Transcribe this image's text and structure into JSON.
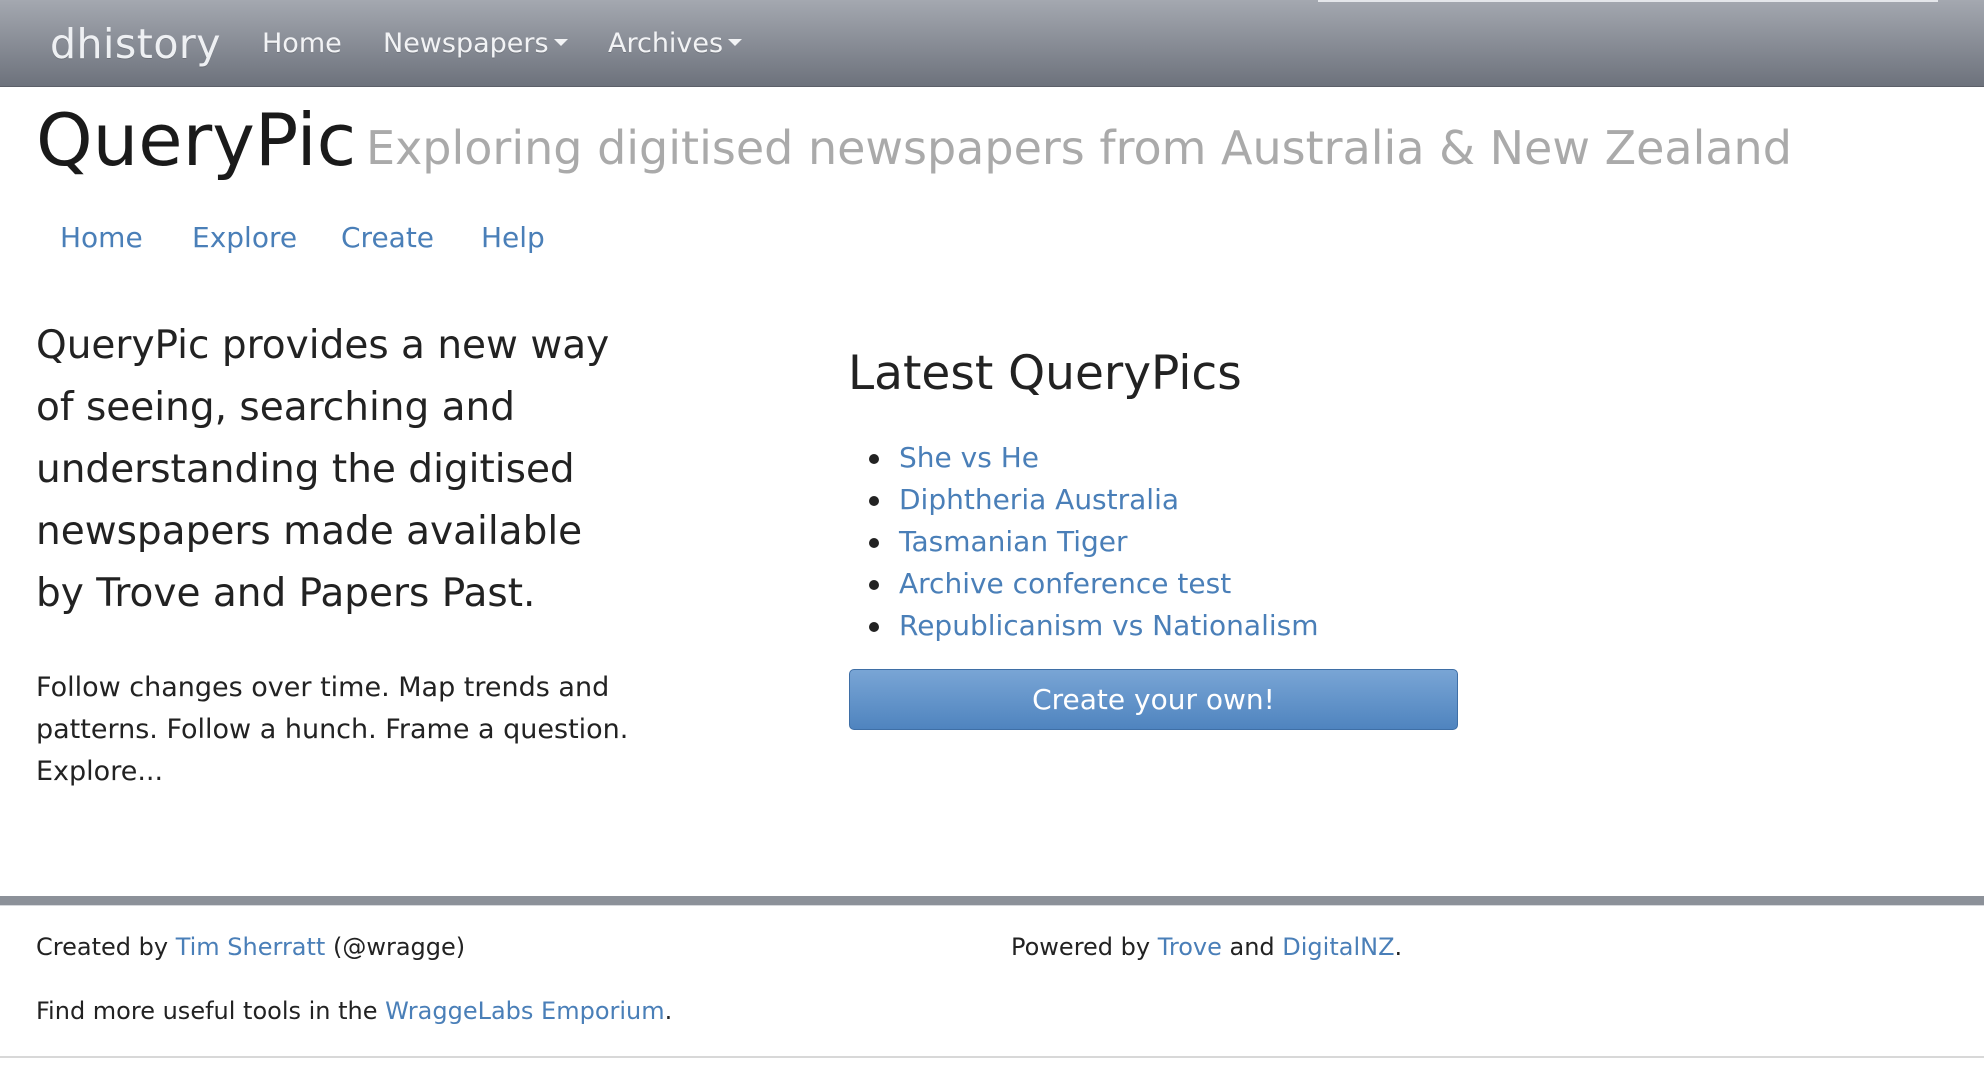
{
  "navbar": {
    "brand": "dhistory",
    "items": [
      {
        "label": "Home",
        "dropdown": false
      },
      {
        "label": "Newspapers",
        "dropdown": true
      },
      {
        "label": "Archives",
        "dropdown": true
      }
    ]
  },
  "header": {
    "title": "QueryPic",
    "subtitle": "Exploring digitised newspapers from Australia & New Zealand"
  },
  "subnav": {
    "items": [
      "Home",
      "Explore",
      "Create",
      "Help"
    ]
  },
  "intro": {
    "lead_lines": [
      "QueryPic provides a new way",
      "of seeing, searching and",
      "understanding the digitised",
      "newspapers made available",
      "by Trove and Papers Past."
    ],
    "body_lines": [
      "Follow changes over time. Map trends and",
      "patterns. Follow a hunch. Frame a question.",
      "Explore..."
    ]
  },
  "latest": {
    "heading": "Latest QueryPics",
    "items": [
      "She vs He",
      "Diphtheria Australia",
      "Tasmanian Tiger",
      "Archive conference test",
      "Republicanism vs Nationalism"
    ],
    "button_label": "Create your own!"
  },
  "footer": {
    "created_prefix": "Created by ",
    "author_link": "Tim Sherratt",
    "author_handle": " (@wragge)",
    "powered_prefix": "Powered by ",
    "trove_link": "Trove",
    "and_text": " and ",
    "digitalnz_link": "DigitalNZ",
    "period": ".",
    "more_prefix": "Find more useful tools in the ",
    "emporium_link": "WraggeLabs Emporium",
    "more_suffix": "."
  },
  "colors": {
    "link": "#4a7fb8",
    "navbar_top": "#a4a8b0",
    "navbar_bottom": "#6d727c",
    "button": "#5b8dc7"
  }
}
